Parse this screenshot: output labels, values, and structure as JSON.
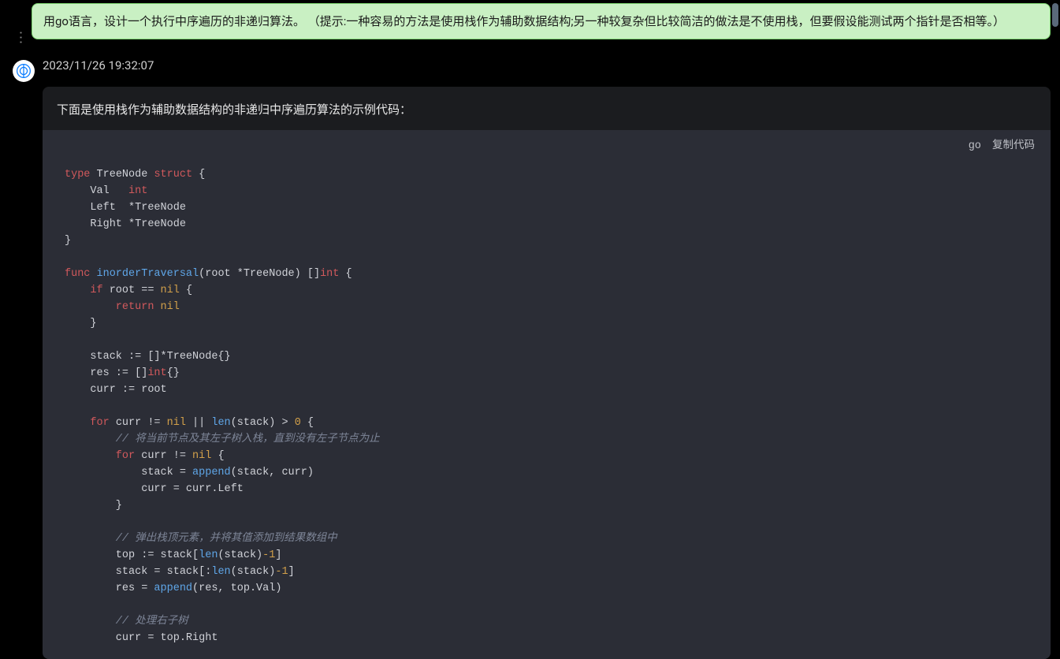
{
  "user_message": "用go语言，设计一个执行中序遍历的非递归算法。 （提示:一种容易的方法是使用栈作为辅助数据结构;另一种较复杂但比较简洁的做法是不使用栈，但要假设能测试两个指针是否相等。）",
  "timestamp": "2023/11/26 19:32:07",
  "intro": "下面是使用栈作为辅助数据结构的非递归中序遍历算法的示例代码：",
  "code_lang": "go",
  "copy_label": "复制代码",
  "code": {
    "l1_type": "type",
    "l1_name": "TreeNode",
    "l1_struct": "struct",
    "l1_brace": " {",
    "l2": "    Val   ",
    "l2_int": "int",
    "l3": "    Left  *TreeNode",
    "l4": "    Right *TreeNode",
    "l5": "}",
    "l7_func": "func",
    "l7_name": " inorderTraversal",
    "l7_sig": "(root *TreeNode)",
    "l7_ret": " []",
    "l7_int": "int",
    "l7_end": " {",
    "l8_if": "    if",
    "l8_cond": " root == ",
    "l8_nil": "nil",
    "l8_end": " {",
    "l9_ret": "        return",
    "l9_nil": " nil",
    "l10": "    }",
    "l12": "    stack := []*TreeNode{}",
    "l13": "    res := []",
    "l13_int": "int",
    "l13_end": "{}",
    "l14": "    curr := root",
    "l16_for": "    for",
    "l16_mid": " curr != ",
    "l16_nil": "nil",
    "l16_or": " || ",
    "l16_len": "len",
    "l16_args": "(stack) > ",
    "l16_zero": "0",
    "l16_end": " {",
    "l17_comment": "        // 将当前节点及其左子树入栈，直到没有左子节点为止",
    "l18_for": "        for",
    "l18_mid": " curr != ",
    "l18_nil": "nil",
    "l18_end": " {",
    "l19_a": "            stack = ",
    "l19_append": "append",
    "l19_b": "(stack, curr)",
    "l20": "            curr = curr.Left",
    "l21": "        }",
    "l23_comment": "        // 弹出栈顶元素，并将其值添加到结果数组中",
    "l24_a": "        top := stack[",
    "l24_len": "len",
    "l24_b": "(stack)",
    "l24_m1": "-1",
    "l24_c": "]",
    "l25_a": "        stack = stack[:",
    "l25_len": "len",
    "l25_b": "(stack)",
    "l25_m1": "-1",
    "l25_c": "]",
    "l26_a": "        res = ",
    "l26_append": "append",
    "l26_b": "(res, top.Val)",
    "l28_comment": "        // 处理右子树",
    "l29": "        curr = top.Right"
  }
}
